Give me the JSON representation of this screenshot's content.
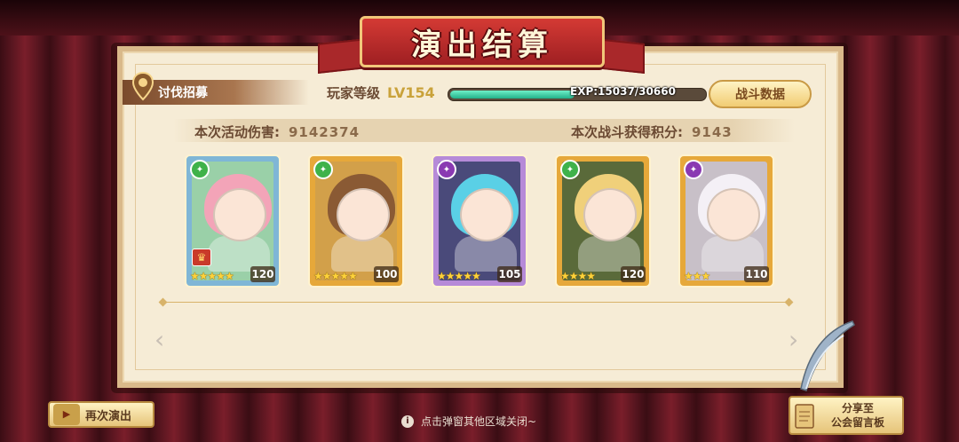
{
  "screen": {
    "title": "演出结算"
  },
  "stage": {
    "name": "讨伐招募"
  },
  "player": {
    "level_label": "玩家等级",
    "level_value": "LV154",
    "exp_text": "EXP:15037/30660",
    "exp_fraction": 0.49
  },
  "buttons": {
    "battle_data": "战斗数据",
    "replay": "再次演出",
    "share": "分享至\n公会留言板"
  },
  "stats": {
    "damage_label": "本次活动伤害:",
    "damage_value": "9142374",
    "score_label": "本次战斗获得积分:",
    "score_value": "9143"
  },
  "cards": [
    {
      "stars": "★★★★★",
      "level": "120",
      "frame": "#7fb6d6",
      "bg": "#9ad0a8",
      "hair": "#f3a4b8",
      "class": "#3fb24a",
      "captain": true
    },
    {
      "stars": "★★★★★",
      "level": "100",
      "frame": "#e6a83a",
      "bg": "#d2a04a",
      "hair": "#8a5a34",
      "class": "#3fb24a",
      "captain": false
    },
    {
      "stars": "★★★★★",
      "level": "105",
      "frame": "#b68ad8",
      "bg": "#4a4a7a",
      "hair": "#5ad0e6",
      "class": "#8a3ab2",
      "captain": false
    },
    {
      "stars": "★★★★",
      "level": "120",
      "frame": "#e6a83a",
      "bg": "#5a6a3a",
      "hair": "#f0d07a",
      "class": "#3fb24a",
      "captain": false
    },
    {
      "stars": "★★★",
      "level": "110",
      "frame": "#e6a83a",
      "bg": "#c8c0c8",
      "hair": "#f4f0f6",
      "class": "#8a3ab2",
      "captain": false
    }
  ],
  "hint": {
    "text": "点击弹窗其他区域关闭~",
    "icon": "info-icon"
  },
  "colors": {
    "panel": "#f6ecd6",
    "banner": "#b8282a",
    "exp_fill": "#2fc79a"
  }
}
